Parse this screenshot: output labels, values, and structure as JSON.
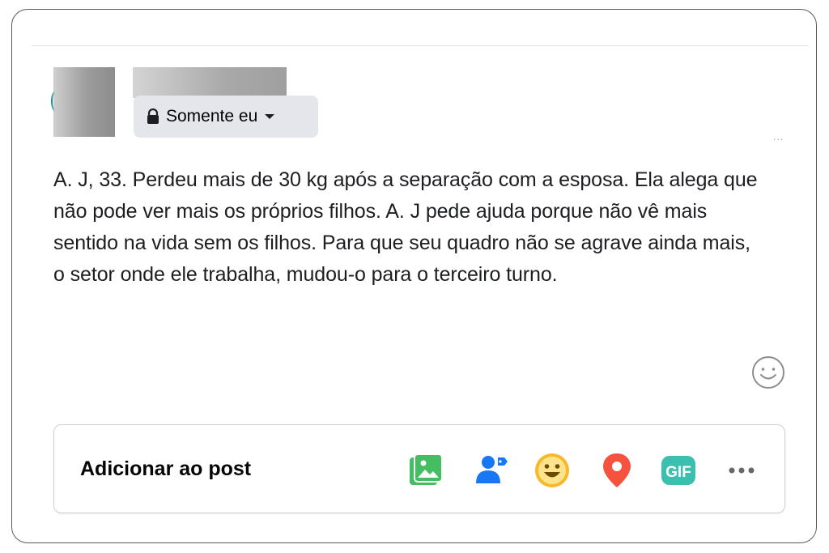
{
  "privacy": {
    "label": "Somente eu",
    "icon": "lock-icon"
  },
  "post": {
    "text": "A. J, 33. Perdeu mais de 30 kg após a separação com a esposa. Ela alega que não pode ver mais os próprios filhos. A. J pede ajuda porque não vê mais sentido na vida sem os filhos. Para que seu quadro não se agrave ainda mais, o setor onde ele trabalha, mudou-o para o terceiro turno."
  },
  "menu_dots": "...",
  "add_to_post": {
    "label": "Adicionar ao post",
    "gif_label": "GIF",
    "icons": [
      "photo-video-icon",
      "tag-people-icon",
      "feeling-activity-icon",
      "check-in-icon",
      "gif-icon",
      "more-icon"
    ]
  },
  "colors": {
    "photo": "#45bd62",
    "tag": "#1877f2",
    "feeling": "#f7b928",
    "location": "#f5533d",
    "gif": "#3bbfae",
    "more": "#65676b"
  }
}
